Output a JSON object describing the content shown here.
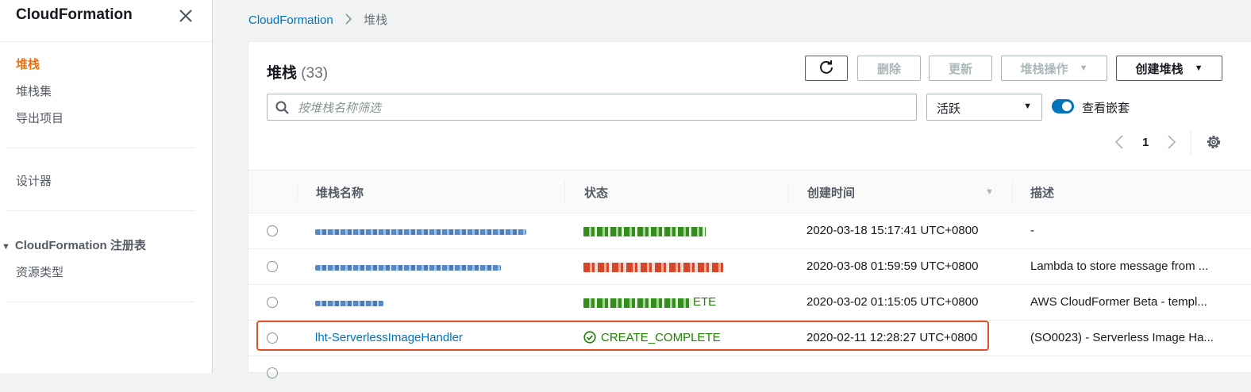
{
  "sidebar": {
    "title": "CloudFormation",
    "nav": [
      {
        "label": "堆栈",
        "active": true
      },
      {
        "label": "堆栈集"
      },
      {
        "label": "导出项目"
      }
    ],
    "designer": "设计器",
    "registry_section": "CloudFormation 注册表",
    "registry_items": [
      {
        "label": "资源类型"
      }
    ]
  },
  "breadcrumb": {
    "root": "CloudFormation",
    "current": "堆栈"
  },
  "panel": {
    "title": "堆栈",
    "count": "(33)",
    "buttons": {
      "delete": "删除",
      "update": "更新",
      "stack_actions": "堆栈操作",
      "create_stack": "创建堆栈"
    },
    "search_placeholder": "按堆栈名称筛选",
    "filter_value": "活跃",
    "toggle_label": "查看嵌套",
    "page_number": "1"
  },
  "table": {
    "columns": [
      "堆栈名称",
      "状态",
      "创建时间",
      "描述"
    ],
    "rows": [
      {
        "name": "",
        "status": "",
        "created": "2020-03-18 15:17:41 UTC+0800",
        "description": "-"
      },
      {
        "name": "",
        "status": "",
        "created": "2020-03-08 01:59:59 UTC+0800",
        "description": "Lambda to store message from ..."
      },
      {
        "name": "",
        "status": "ETE",
        "created": "2020-03-02 01:15:05 UTC+0800",
        "description": "AWS CloudFormer Beta - templ..."
      },
      {
        "name": "lht-ServerlessImageHandler",
        "status": "CREATE_COMPLETE",
        "created": "2020-02-11 12:28:27 UTC+0800",
        "description": "(SO0023) - Serverless Image Ha..."
      }
    ]
  },
  "colors": {
    "accent": "#ec7211",
    "link": "#0073bb",
    "success": "#1d8102",
    "error": "#d13212",
    "highlight": "#e0512a"
  },
  "icons": [
    "close-icon",
    "chevron-right-icon",
    "refresh-icon",
    "search-icon",
    "caret-down-icon",
    "chevron-left-icon",
    "settings-gear-icon",
    "check-circle-icon"
  ]
}
